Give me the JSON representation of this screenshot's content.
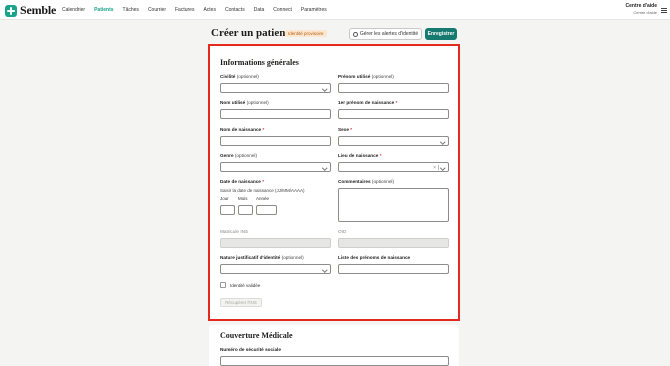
{
  "app": {
    "name": "Semble"
  },
  "nav": {
    "items": [
      "Calendrier",
      "Patients",
      "Tâches",
      "Courrier",
      "Factures",
      "Actes",
      "Contacts",
      "Data",
      "Connect",
      "Paramètres"
    ],
    "active": "Patients"
  },
  "help": {
    "title": "Centre d'aide",
    "subtitle": "Centre d'aide"
  },
  "page": {
    "title": "Créer un patient",
    "badge": "Identité provisoire",
    "alerts_button": "Gérer les alertes d'identité",
    "save_button": "Enregistrer"
  },
  "section_general": {
    "title": "Informations générales",
    "civilite": {
      "label": "Civilité",
      "optional": "(optionnel)",
      "value": ""
    },
    "prenom_utilise": {
      "label": "Prénom utilisé",
      "optional": "(optionnel)",
      "value": ""
    },
    "nom_utilise": {
      "label": "Nom utilisé",
      "optional": "(optionnel)",
      "value": ""
    },
    "premier_prenom": {
      "label": "1er prénom de naissance",
      "required": "*",
      "value": ""
    },
    "nom_naissance": {
      "label": "Nom de naissance",
      "required": "*",
      "value": ""
    },
    "sexe": {
      "label": "Sexe",
      "required": "*",
      "value": ""
    },
    "genre": {
      "label": "Genre",
      "optional": "(optionnel)",
      "value": ""
    },
    "lieu_naissance": {
      "label": "Lieu de naissance",
      "required": "*",
      "value": ""
    },
    "date_naissance": {
      "label": "Date de naissance",
      "required": "*",
      "hint": "Saisir la date de naissance (JJ/MM/AAAA)",
      "jour": "Jour",
      "mois": "Mois",
      "annee": "Année"
    },
    "commentaires": {
      "label": "Commentaires",
      "optional": "(optionnel)",
      "value": ""
    },
    "matricule_ins": {
      "label": "Matricule INS",
      "value": ""
    },
    "oid": {
      "label": "OID",
      "value": ""
    },
    "nature_justificatif": {
      "label": "Nature justificatif d'identité",
      "optional": "(optionnel)",
      "value": ""
    },
    "liste_prenoms": {
      "label": "Liste des prénoms de naissance",
      "value": ""
    },
    "identite_validee": {
      "label": "Identité validée",
      "checked": false
    },
    "recuperer_button": "Récupérer l'INS"
  },
  "section_coverage": {
    "title": "Couverture Médicale",
    "numero_ss": {
      "label": "Numéro de sécurité sociale",
      "value": ""
    }
  },
  "colors": {
    "accent": "#19a38a",
    "save": "#177a70",
    "highlight": "#e42a1e",
    "badge_bg": "#fde6cf",
    "badge_text": "#b35d12"
  }
}
